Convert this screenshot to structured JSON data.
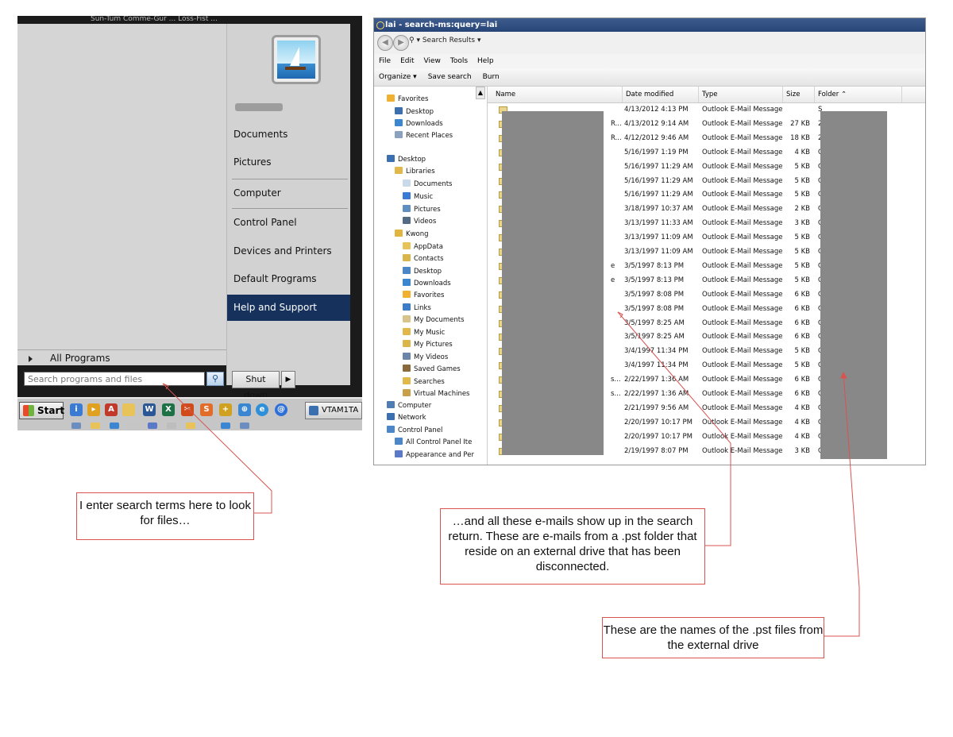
{
  "start_menu": {
    "top_strip": "Sun-Tum     Comme-Gur ...    Loss-Fist ...",
    "right_items": [
      {
        "label": "Documents"
      },
      {
        "label": "Pictures"
      },
      {
        "label": "Computer"
      },
      {
        "label": "Control Panel"
      },
      {
        "label": "Devices and Printers"
      },
      {
        "label": "Default Programs"
      },
      {
        "label": "Help and Support"
      }
    ],
    "all_programs": "All Programs",
    "search_placeholder": "Search programs and files",
    "shutdown_label": "Shut down",
    "shutdown_arrow": "▶"
  },
  "taskbar": {
    "start_label": "Start",
    "task_label": "VTAM1TA"
  },
  "explorer": {
    "title": "lai - search-ms:query=lai",
    "address": "▾ Search Results ▾",
    "menu": [
      "File",
      "Edit",
      "View",
      "Tools",
      "Help"
    ],
    "toolbar": [
      "Organize ▾",
      "Save search",
      "Burn"
    ],
    "nav_items": [
      {
        "label": "Favorites",
        "icon": "star-icon",
        "color": "#f0b030",
        "indent": 0
      },
      {
        "label": "Desktop",
        "icon": "desktop-icon",
        "color": "#3b6fb0",
        "indent": 1
      },
      {
        "label": "Downloads",
        "icon": "downloads-icon",
        "color": "#3a86d0",
        "indent": 1
      },
      {
        "label": "Recent Places",
        "icon": "recent-places-icon",
        "color": "#8aa2bf",
        "indent": 1
      },
      {
        "label": "Desktop",
        "icon": "desktop-icon",
        "color": "#3b6fb0",
        "indent": 0
      },
      {
        "label": "Libraries",
        "icon": "libraries-icon",
        "color": "#e3b84a",
        "indent": 1
      },
      {
        "label": "Documents",
        "icon": "documents-icon",
        "color": "#c9d9ea",
        "indent": 2
      },
      {
        "label": "Music",
        "icon": "music-icon",
        "color": "#3a7bd5",
        "indent": 2
      },
      {
        "label": "Pictures",
        "icon": "pictures-icon",
        "color": "#5f8fc0",
        "indent": 2
      },
      {
        "label": "Videos",
        "icon": "videos-icon",
        "color": "#556b85",
        "indent": 2
      },
      {
        "label": "Kwong",
        "icon": "user-folder-icon",
        "color": "#e0b640",
        "indent": 1
      },
      {
        "label": "AppData",
        "icon": "folder-icon",
        "color": "#e8c35a",
        "indent": 2
      },
      {
        "label": "Contacts",
        "icon": "contacts-icon",
        "color": "#d9b54a",
        "indent": 2
      },
      {
        "label": "Desktop",
        "icon": "folder-icon",
        "color": "#4a86c8",
        "indent": 2
      },
      {
        "label": "Downloads",
        "icon": "folder-icon",
        "color": "#3a86d0",
        "indent": 2
      },
      {
        "label": "Favorites",
        "icon": "folder-icon",
        "color": "#f0b030",
        "indent": 2
      },
      {
        "label": "Links",
        "icon": "folder-icon",
        "color": "#3d7cc9",
        "indent": 2
      },
      {
        "label": "My Documents",
        "icon": "folder-icon",
        "color": "#d8c48a",
        "indent": 2
      },
      {
        "label": "My Music",
        "icon": "folder-icon",
        "color": "#e3b84a",
        "indent": 2
      },
      {
        "label": "My Pictures",
        "icon": "folder-icon",
        "color": "#d9b54a",
        "indent": 2
      },
      {
        "label": "My Videos",
        "icon": "folder-icon",
        "color": "#6b86a8",
        "indent": 2
      },
      {
        "label": "Saved Games",
        "icon": "folder-icon",
        "color": "#8a6a3a",
        "indent": 2
      },
      {
        "label": "Searches",
        "icon": "folder-icon",
        "color": "#e3b84a",
        "indent": 2
      },
      {
        "label": "Virtual Machines",
        "icon": "folder-icon",
        "color": "#c9a04a",
        "indent": 2
      },
      {
        "label": "Computer",
        "icon": "computer-icon",
        "color": "#4f7db3",
        "indent": 0
      },
      {
        "label": "Network",
        "icon": "network-icon",
        "color": "#3b6fb0",
        "indent": 0
      },
      {
        "label": "Control Panel",
        "icon": "control-panel-icon",
        "color": "#4a86c8",
        "indent": 0
      },
      {
        "label": "All Control Panel Ite",
        "icon": "control-panel-icon",
        "color": "#4a86c8",
        "indent": 1
      },
      {
        "label": "Appearance and Per",
        "icon": "appearance-icon",
        "color": "#5a79c8",
        "indent": 1
      }
    ],
    "columns": [
      "Name",
      "Date modified",
      "Type",
      "Size",
      "Folder ⌃"
    ],
    "rows": [
      {
        "name_tail": "",
        "date": "4/13/2012 4:13 PM",
        "type": "Outlook E-Mail Message",
        "size": "",
        "folder": "S"
      },
      {
        "name_tail": "R...",
        "date": "4/13/2012 9:14 AM",
        "type": "Outlook E-Mail Message",
        "size": "27 KB",
        "folder": "2"
      },
      {
        "name_tail": "R...",
        "date": "4/12/2012 9:46 AM",
        "type": "Outlook E-Mail Message",
        "size": "18 KB",
        "folder": "2"
      },
      {
        "name_tail": "",
        "date": "5/16/1997 1:19 PM",
        "type": "Outlook E-Mail Message",
        "size": "4 KB",
        "folder": "C"
      },
      {
        "name_tail": "",
        "date": "5/16/1997 11:29 AM",
        "type": "Outlook E-Mail Message",
        "size": "5 KB",
        "folder": "C"
      },
      {
        "name_tail": "",
        "date": "5/16/1997 11:29 AM",
        "type": "Outlook E-Mail Message",
        "size": "5 KB",
        "folder": "C"
      },
      {
        "name_tail": "",
        "date": "5/16/1997 11:29 AM",
        "type": "Outlook E-Mail Message",
        "size": "5 KB",
        "folder": "C"
      },
      {
        "name_tail": "",
        "date": "3/18/1997 10:37 AM",
        "type": "Outlook E-Mail Message",
        "size": "2 KB",
        "folder": "C"
      },
      {
        "name_tail": "",
        "date": "3/13/1997 11:33 AM",
        "type": "Outlook E-Mail Message",
        "size": "3 KB",
        "folder": "C"
      },
      {
        "name_tail": "",
        "date": "3/13/1997 11:09 AM",
        "type": "Outlook E-Mail Message",
        "size": "5 KB",
        "folder": "C"
      },
      {
        "name_tail": "",
        "date": "3/13/1997 11:09 AM",
        "type": "Outlook E-Mail Message",
        "size": "5 KB",
        "folder": "C"
      },
      {
        "name_tail": "e",
        "date": "3/5/1997 8:13 PM",
        "type": "Outlook E-Mail Message",
        "size": "5 KB",
        "folder": "C"
      },
      {
        "name_tail": "e",
        "date": "3/5/1997 8:13 PM",
        "type": "Outlook E-Mail Message",
        "size": "5 KB",
        "folder": "C"
      },
      {
        "name_tail": "",
        "date": "3/5/1997 8:08 PM",
        "type": "Outlook E-Mail Message",
        "size": "6 KB",
        "folder": "C"
      },
      {
        "name_tail": "",
        "date": "3/5/1997 8:08 PM",
        "type": "Outlook E-Mail Message",
        "size": "6 KB",
        "folder": "C"
      },
      {
        "name_tail": "",
        "date": "3/5/1997 8:25 AM",
        "type": "Outlook E-Mail Message",
        "size": "6 KB",
        "folder": "C"
      },
      {
        "name_tail": "",
        "date": "3/5/1997 8:25 AM",
        "type": "Outlook E-Mail Message",
        "size": "6 KB",
        "folder": "C"
      },
      {
        "name_tail": "",
        "date": "3/4/1997 11:34 PM",
        "type": "Outlook E-Mail Message",
        "size": "5 KB",
        "folder": "C"
      },
      {
        "name_tail": "",
        "date": "3/4/1997 11:34 PM",
        "type": "Outlook E-Mail Message",
        "size": "5 KB",
        "folder": "C"
      },
      {
        "name_tail": "s...",
        "date": "2/22/1997 1:36 AM",
        "type": "Outlook E-Mail Message",
        "size": "6 KB",
        "folder": "C"
      },
      {
        "name_tail": "s...",
        "date": "2/22/1997 1:36 AM",
        "type": "Outlook E-Mail Message",
        "size": "6 KB",
        "folder": "C"
      },
      {
        "name_tail": "",
        "date": "2/21/1997 9:56 AM",
        "type": "Outlook E-Mail Message",
        "size": "4 KB",
        "folder": "C"
      },
      {
        "name_tail": "",
        "date": "2/20/1997 10:17 PM",
        "type": "Outlook E-Mail Message",
        "size": "4 KB",
        "folder": "C"
      },
      {
        "name_tail": "",
        "date": "2/20/1997 10:17 PM",
        "type": "Outlook E-Mail Message",
        "size": "4 KB",
        "folder": "C"
      },
      {
        "name_tail": "",
        "date": "2/19/1997 8:07 PM",
        "type": "Outlook E-Mail Message",
        "size": "3 KB",
        "folder": "C"
      }
    ]
  },
  "callouts": {
    "search_note": "I enter search terms here to look for files…",
    "emails_note": "…and all these e-mails show up in the search return.  These are e-mails from a .pst folder that reside on an external drive that has been disconnected.",
    "pst_note": "These are the names of the .pst files from the external drive"
  },
  "colors": {
    "accent_selected": "#16325c",
    "callout_border": "#d9534f",
    "redaction": "#888888"
  }
}
